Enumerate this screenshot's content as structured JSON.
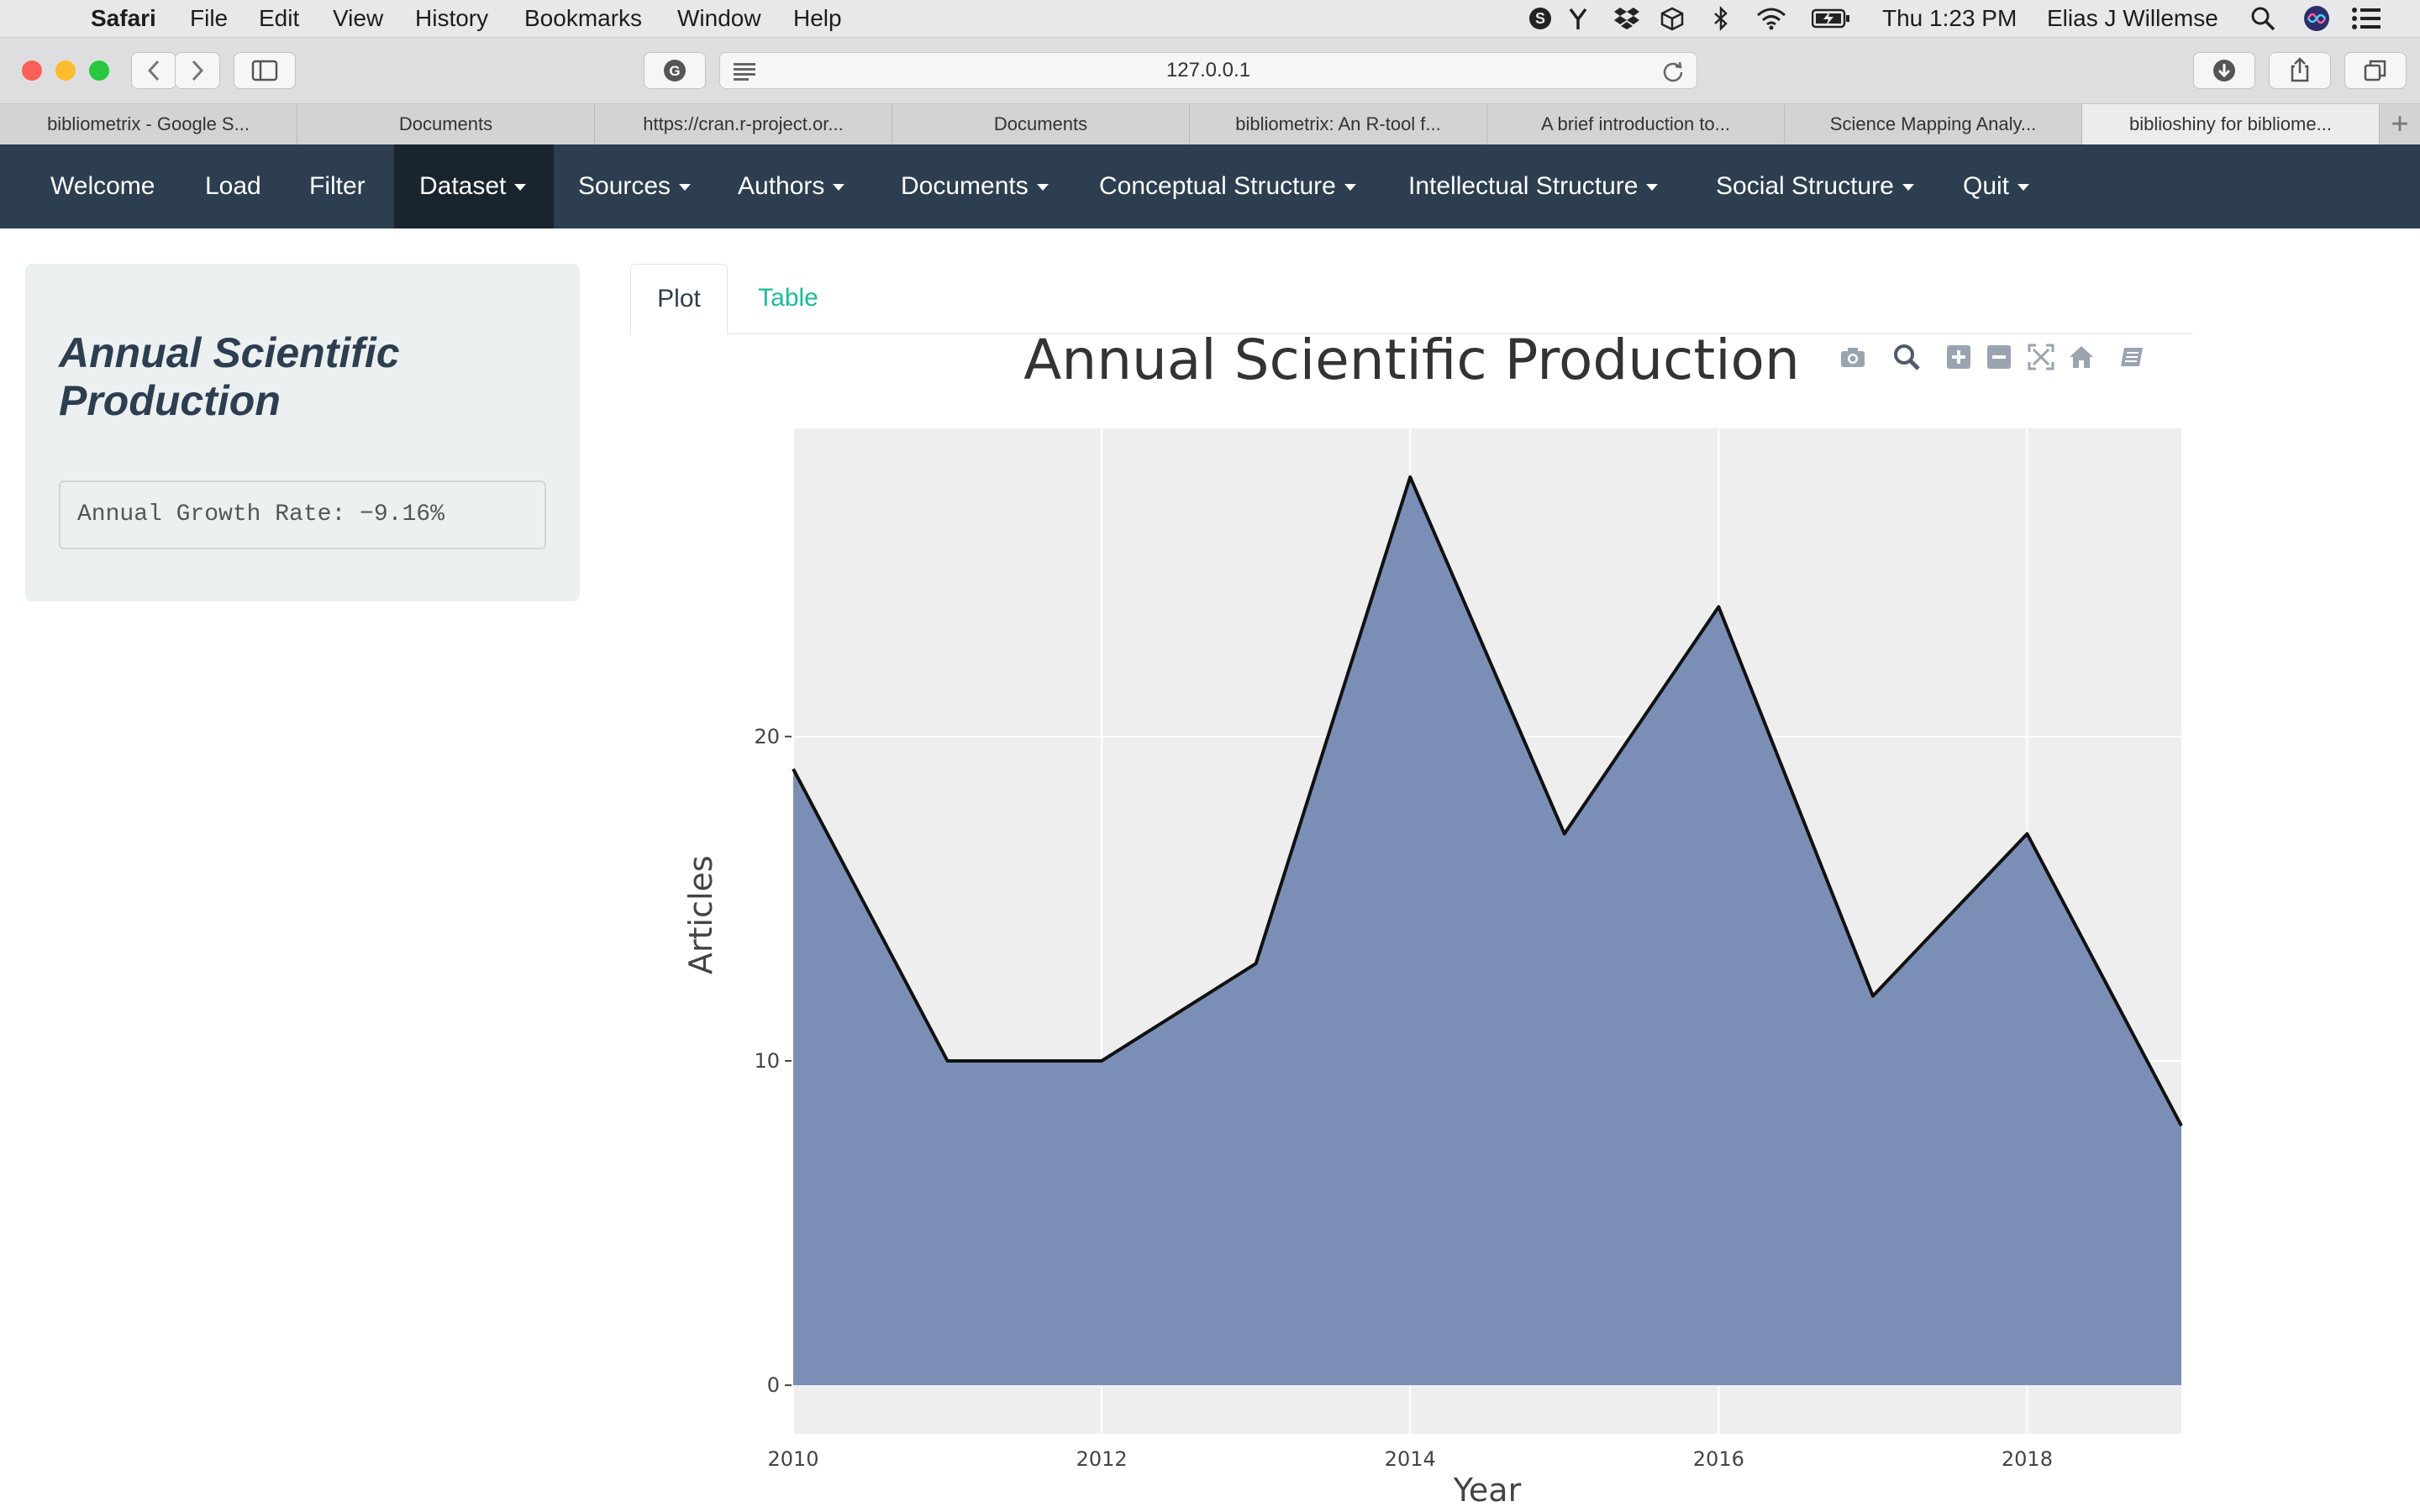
{
  "menubar": {
    "app": "Safari",
    "items": [
      "File",
      "Edit",
      "View",
      "History",
      "Bookmarks",
      "Window",
      "Help"
    ],
    "clock": "Thu 1:23 PM",
    "user": "Elias J Willemse"
  },
  "browser": {
    "url": "127.0.0.1",
    "tabs": [
      "bibliometrix - Google S...",
      "Documents",
      "https://cran.r-project.or...",
      "Documents",
      "bibliometrix: An R-tool f...",
      "A brief introduction to...",
      "Science Mapping Analy...",
      "biblioshiny for bibliome..."
    ]
  },
  "navbar": {
    "items": [
      "Welcome",
      "Load",
      "Filter",
      "Dataset",
      "Sources",
      "Authors",
      "Documents",
      "Conceptual Structure",
      "Intellectual Structure",
      "Social Structure",
      "Quit"
    ]
  },
  "sidebar": {
    "title": "Annual Scientific Production",
    "growth": "Annual Growth Rate: −9.16%"
  },
  "content_tabs": {
    "plot": "Plot",
    "table": "Table"
  },
  "chart_data": {
    "type": "area",
    "title": "Annual Scientific Production",
    "xlabel": "Year",
    "ylabel": "Articles",
    "x": [
      2010,
      2011,
      2012,
      2013,
      2014,
      2015,
      2016,
      2017,
      2018,
      2019
    ],
    "y": [
      19,
      10,
      10,
      13,
      28,
      17,
      24,
      12,
      17,
      8
    ],
    "xticks": [
      "2010",
      "2012",
      "2014",
      "2016",
      "2018"
    ],
    "yticks": [
      "0",
      "10",
      "20"
    ],
    "xlim": [
      2010,
      2019
    ],
    "ylim": [
      -1.5,
      29.5
    ],
    "fill_color": "#7b8fb6",
    "line_color": "#111111",
    "plot_bg": "#eeeeee",
    "grid": true
  }
}
